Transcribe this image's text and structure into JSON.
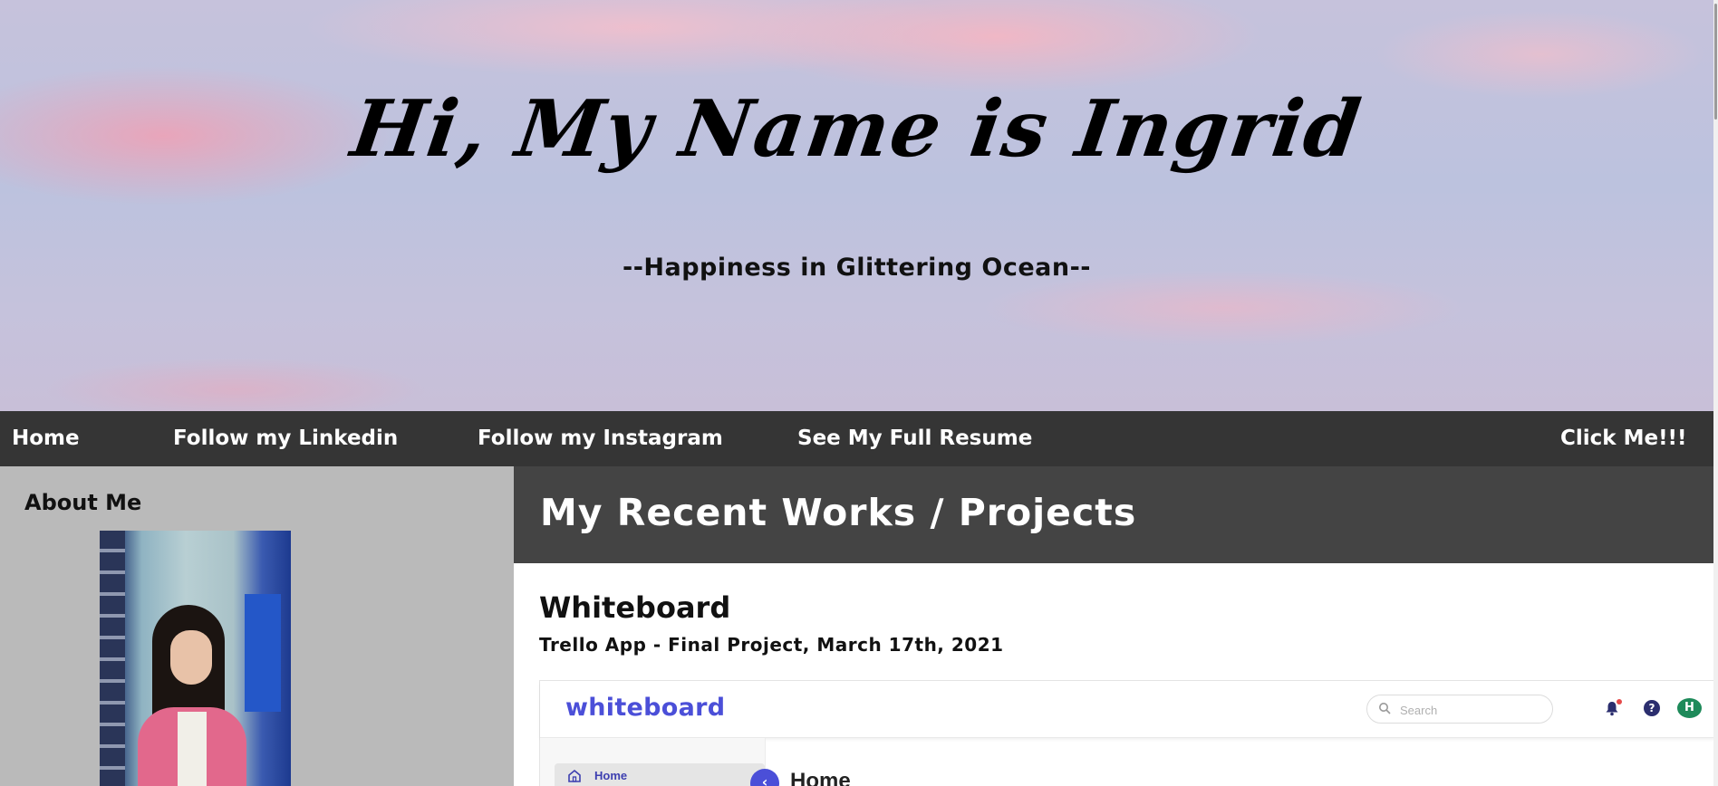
{
  "hero": {
    "title": "Hi, My Name is Ingrid",
    "subtitle": "--Happiness in Glittering Ocean--"
  },
  "nav": {
    "items": [
      {
        "label": "Home"
      },
      {
        "label": "Follow my Linkedin"
      },
      {
        "label": "Follow my Instagram"
      },
      {
        "label": "See My Full Resume"
      }
    ],
    "cta_label": "Click Me!!!"
  },
  "sidebar": {
    "heading": "About Me"
  },
  "main": {
    "section_title": "My Recent Works / Projects",
    "project": {
      "title": "Whiteboard",
      "subtitle": "Trello App - Final Project, March 17th, 2021"
    }
  },
  "whiteboard_screenshot": {
    "logo": "whiteboard",
    "search_placeholder": "Search",
    "help_glyph": "?",
    "avatar_initial": "H",
    "sidebar_home_label": "Home",
    "collapse_glyph": "‹",
    "page_title": "Home",
    "accent_color": "#4b4fd8"
  },
  "colors": {
    "navbar": "#353535",
    "sidebar": "#bababa",
    "projects_header": "#444444"
  }
}
